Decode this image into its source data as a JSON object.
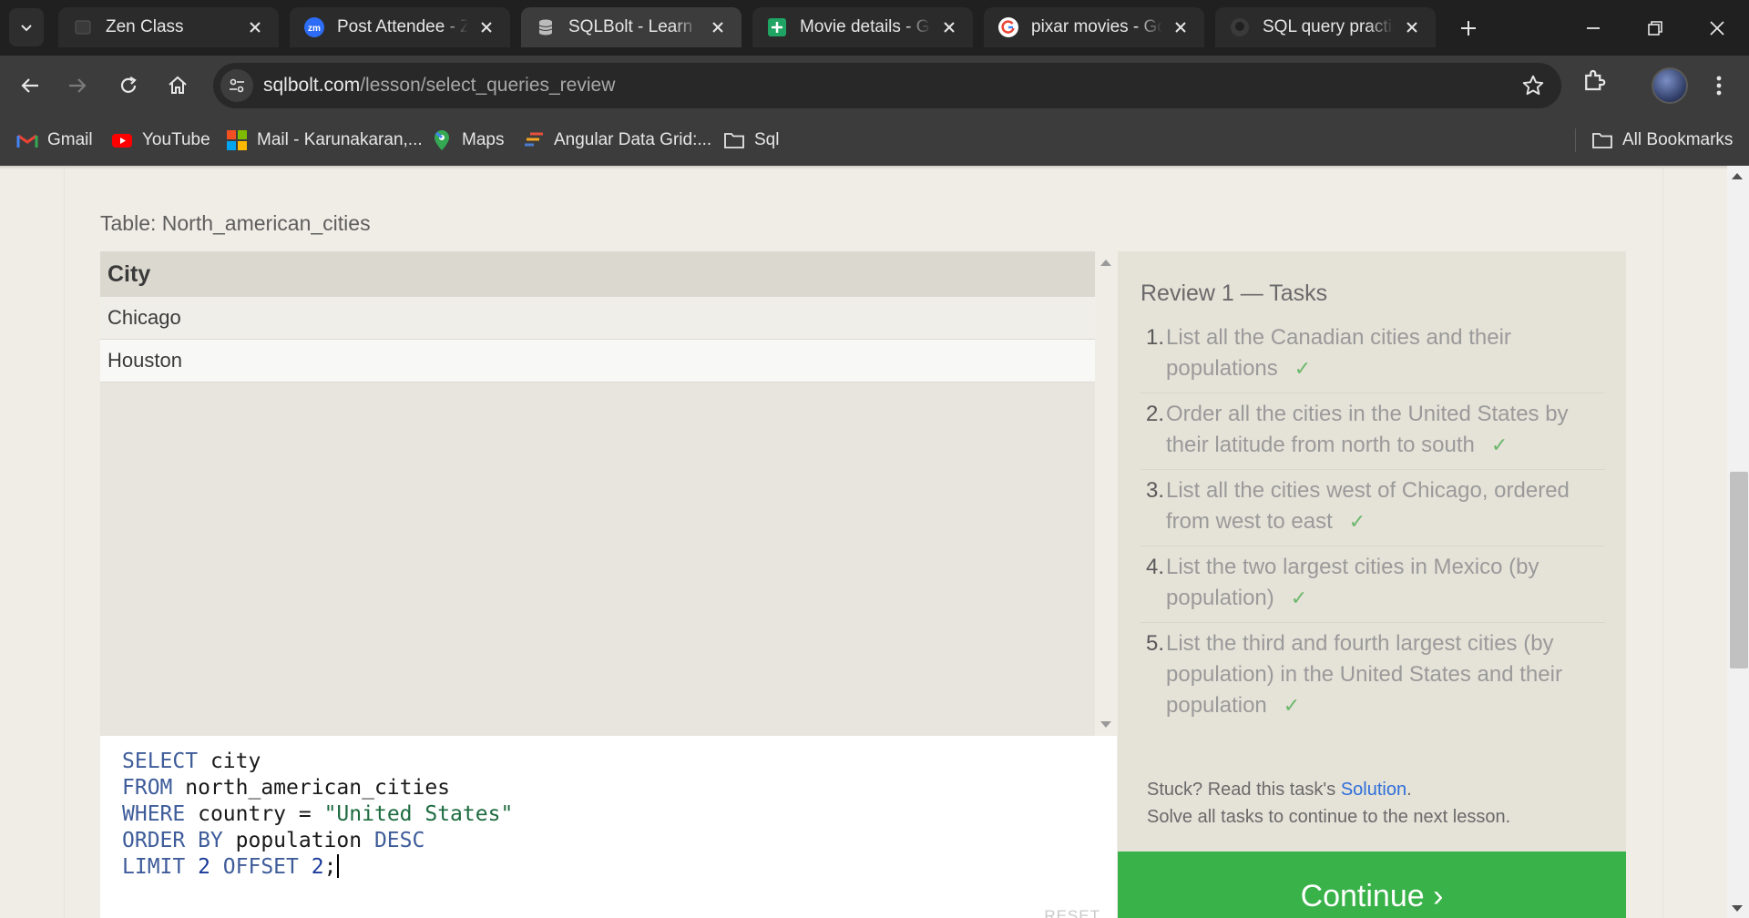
{
  "browser": {
    "tabs": [
      {
        "title": "Zen Class",
        "icon": "zen-class-icon"
      },
      {
        "title": "Post Attendee - Zoom",
        "icon": "zoom-icon"
      },
      {
        "title": "SQLBolt - Learn SQL",
        "icon": "sqlbolt-icon",
        "active": true
      },
      {
        "title": "Movie details - Google Sheets",
        "icon": "google-sheets-icon"
      },
      {
        "title": "pixar movies - Google Search",
        "icon": "google-icon"
      },
      {
        "title": "SQL query practice",
        "icon": "github-icon"
      }
    ],
    "url": {
      "domain": "sqlbolt.com",
      "path": "/lesson/select_queries_review"
    },
    "bookmarks": [
      {
        "label": "Gmail",
        "icon": "gmail-icon"
      },
      {
        "label": "YouTube",
        "icon": "youtube-icon"
      },
      {
        "label": "Mail - Karunakaran,...",
        "icon": "microsoft-icon"
      },
      {
        "label": "Maps",
        "icon": "maps-icon"
      },
      {
        "label": "Angular Data Grid:...",
        "icon": "ag-grid-icon"
      },
      {
        "label": "Sql",
        "icon": "folder-icon"
      }
    ],
    "all_bookmarks": "All Bookmarks"
  },
  "lesson": {
    "table_title": "Table: North_american_cities",
    "results": {
      "columns": [
        "City"
      ],
      "rows": [
        [
          "Chicago"
        ],
        [
          "Houston"
        ]
      ]
    },
    "editor": {
      "lines": [
        {
          "kw": "SELECT",
          "rest": " city"
        },
        {
          "kw": "FROM",
          "rest": " north_american_cities"
        },
        {
          "kw": "WHERE",
          "rest": " country = ",
          "str": "\"United States\""
        },
        {
          "kw": "ORDER BY",
          "rest": " population ",
          "kw2": "DESC"
        },
        {
          "kw": "LIMIT",
          "num": " 2 ",
          "kw2": "OFFSET",
          "num2": " 2",
          "rest": ";"
        }
      ],
      "reset_label": "RESET"
    },
    "tasks": {
      "title": "Review 1 — Tasks",
      "items": [
        {
          "num": "1.",
          "text": "List all the Canadian cities and their populations",
          "done": "✓"
        },
        {
          "num": "2.",
          "text": "Order all the cities in the United States by their latitude from north to south",
          "done": "✓"
        },
        {
          "num": "3.",
          "text": "List all the cities west of Chicago, ordered from west to east",
          "done": "✓"
        },
        {
          "num": "4.",
          "text": "List the two largest cities in Mexico (by population)",
          "done": "✓"
        },
        {
          "num": "5.",
          "text": "List the third and fourth largest cities (by population) in the United States and their population",
          "done": "✓"
        }
      ],
      "stuck_prefix": "Stuck? Read this task's ",
      "solution_link": "Solution",
      "stuck_suffix": ".",
      "solve_all": "Solve all tasks to continue to the next lesson.",
      "continue_label": "Continue ›"
    }
  },
  "colors": {
    "continue": "#38b249",
    "link": "#2e6fd9",
    "check": "#6cb86c"
  }
}
